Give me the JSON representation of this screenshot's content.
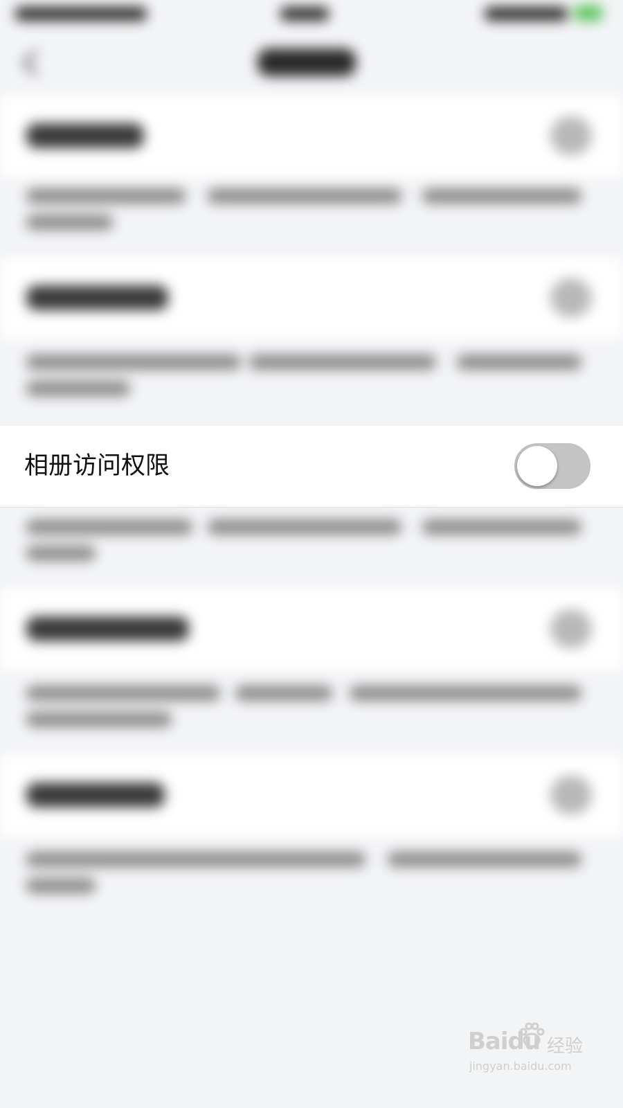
{
  "settings": {
    "album_permission": {
      "label": "相册访问权限",
      "enabled": false
    }
  },
  "watermark": {
    "brand": "Baidu",
    "brand_cn": "经验",
    "url": "jingyan.baidu.com"
  },
  "colors": {
    "page_bg": "#f3f4f6",
    "row_bg": "#ffffff",
    "toggle_off_bg": "#c5c5c5",
    "status_battery": "#58c35a",
    "watermark": "#cfcfcf"
  }
}
